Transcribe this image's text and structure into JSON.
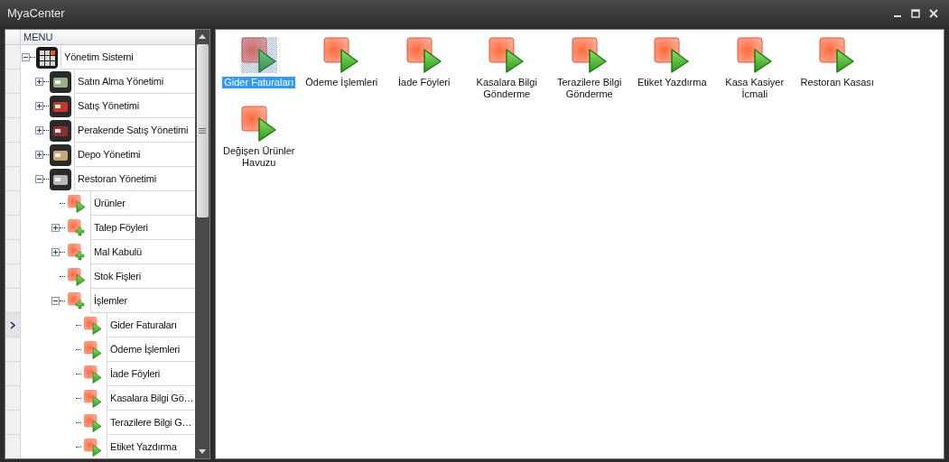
{
  "window": {
    "title": "MyaCenter"
  },
  "menu": {
    "header": "MENU",
    "tree": [
      {
        "label": "Yönetim Sistemi",
        "kind": "root",
        "expanded": true,
        "selected": false,
        "children": [
          {
            "label": "Satın Alma Yönetimi",
            "kind": "module",
            "expanded": false,
            "selected": false
          },
          {
            "label": "Satış Yönetimi",
            "kind": "module",
            "expanded": false,
            "selected": false
          },
          {
            "label": "Perakende Satış Yönetimi",
            "kind": "module",
            "expanded": false,
            "selected": false
          },
          {
            "label": "Depo Yönetimi",
            "kind": "module",
            "expanded": false,
            "selected": false
          },
          {
            "label": "Restoran Yönetimi",
            "kind": "module",
            "expanded": true,
            "selected": false,
            "children": [
              {
                "label": "Ürünler",
                "kind": "form",
                "selected": false
              },
              {
                "label": "Talep Föyleri",
                "kind": "folder",
                "expanded": false,
                "selected": false
              },
              {
                "label": "Mal Kabulü",
                "kind": "folder",
                "expanded": false,
                "selected": false
              },
              {
                "label": "Stok Fişleri",
                "kind": "form",
                "selected": false
              },
              {
                "label": "İşlemler",
                "kind": "folder",
                "expanded": true,
                "selected": false,
                "children": [
                  {
                    "label": "Gider Faturaları",
                    "kind": "form",
                    "selected": true
                  },
                  {
                    "label": "Ödeme İşlemleri",
                    "kind": "form",
                    "selected": false
                  },
                  {
                    "label": "İade Föyleri",
                    "kind": "form",
                    "selected": false
                  },
                  {
                    "label": "Kasalara Bilgi Gö…",
                    "kind": "form",
                    "selected": false
                  },
                  {
                    "label": "Terazilere Bilgi G…",
                    "kind": "form",
                    "selected": false
                  },
                  {
                    "label": "Etiket Yazdırma",
                    "kind": "form",
                    "selected": false
                  }
                ]
              }
            ]
          }
        ]
      }
    ]
  },
  "content": {
    "items": [
      {
        "label": "Gider Faturaları",
        "selected": true
      },
      {
        "label": "Ödeme İşlemleri",
        "selected": false
      },
      {
        "label": "İade Föyleri",
        "selected": false
      },
      {
        "label": "Kasalara Bilgi Gönderme",
        "selected": false
      },
      {
        "label": "Terazilere Bilgi Gönderme",
        "selected": false
      },
      {
        "label": "Etiket Yazdırma",
        "selected": false
      },
      {
        "label": "Kasa Kasiyer İcmali",
        "selected": false
      },
      {
        "label": "Restoran Kasası",
        "selected": false
      },
      {
        "label": "Değişen Ürünler Havuzu",
        "selected": false
      }
    ]
  }
}
